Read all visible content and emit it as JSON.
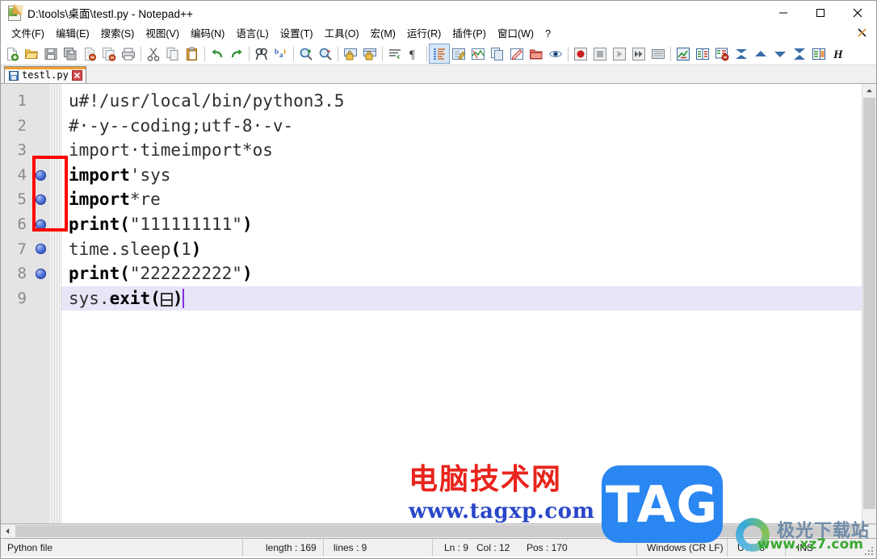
{
  "window": {
    "title": "D:\\tools\\桌面\\testl.py - Notepad++",
    "icon": "notepad-plus-plus-icon",
    "controls": {
      "minimize": "–",
      "maximize": "□",
      "close": "✕"
    }
  },
  "menu": {
    "items": [
      {
        "label": "文件(F)"
      },
      {
        "label": "编辑(E)"
      },
      {
        "label": "搜索(S)"
      },
      {
        "label": "视图(V)"
      },
      {
        "label": "编码(N)"
      },
      {
        "label": "语言(L)"
      },
      {
        "label": "设置(T)"
      },
      {
        "label": "工具(O)"
      },
      {
        "label": "宏(M)"
      },
      {
        "label": "运行(R)"
      },
      {
        "label": "插件(P)"
      },
      {
        "label": "窗口(W)"
      },
      {
        "label": "?"
      }
    ],
    "close_document_label": "✕"
  },
  "toolbar": {
    "groups": [
      [
        "new-file-icon",
        "open-file-icon",
        "save-icon",
        "save-all-icon",
        "close-file-icon",
        "close-all-icon",
        "print-icon"
      ],
      [
        "cut-icon",
        "copy-icon",
        "paste-icon"
      ],
      [
        "undo-icon",
        "redo-icon"
      ],
      [
        "find-icon",
        "replace-icon"
      ],
      [
        "zoom-in-icon",
        "zoom-out-icon"
      ],
      [
        "sync-vertical-scroll-icon",
        "sync-horizontal-scroll-icon"
      ],
      [
        "word-wrap-icon",
        "show-all-characters-icon"
      ],
      [
        "indent-guide-icon",
        "user-defined-language-icon",
        "document-map-icon",
        "function-list-icon",
        "edit-annotation-icon",
        "folder-workspace-icon",
        "show-spy-icon"
      ],
      [
        "macro-record-icon",
        "macro-stop-icon",
        "macro-play-icon",
        "macro-playback-multiple-icon",
        "macro-save-icon"
      ],
      [
        "run-icon",
        "compare-icon",
        "compare-clear-icon",
        "collapse-all-icon",
        "collapse-up-icon",
        "expand-down-icon",
        "expand-all-icon",
        "settings-compare-icon",
        "hex-editor-icon"
      ]
    ]
  },
  "tabs": [
    {
      "label": "testl.py",
      "icon": "saved-document-icon",
      "close": "✕",
      "active": true
    }
  ],
  "editor": {
    "lines": [
      {
        "num": "1",
        "bookmark": false,
        "current": false,
        "tokens": [
          {
            "t": "u#!/usr/local/bin/python3.5",
            "style": "plain"
          }
        ]
      },
      {
        "num": "2",
        "bookmark": false,
        "current": false,
        "tokens": [
          {
            "t": "#·-y--coding;utf-8·-v-",
            "style": "plain"
          }
        ]
      },
      {
        "num": "3",
        "bookmark": false,
        "current": false,
        "tokens": [
          {
            "t": "import·timeimport*os",
            "style": "plain"
          }
        ]
      },
      {
        "num": "4",
        "bookmark": true,
        "current": false,
        "tokens": [
          {
            "t": "import",
            "style": "kw"
          },
          {
            "t": "'sys",
            "style": "plain"
          }
        ]
      },
      {
        "num": "5",
        "bookmark": true,
        "current": false,
        "tokens": [
          {
            "t": "import",
            "style": "kw"
          },
          {
            "t": "*re",
            "style": "plain"
          }
        ]
      },
      {
        "num": "6",
        "bookmark": true,
        "current": false,
        "tokens": [
          {
            "t": "print",
            "style": "kw"
          },
          {
            "t": "(",
            "style": "kw"
          },
          {
            "t": "\"111111111\"",
            "style": "plain"
          },
          {
            "t": ")",
            "style": "kw"
          }
        ]
      },
      {
        "num": "7",
        "bookmark": true,
        "current": false,
        "tokens": [
          {
            "t": "time.sleep",
            "style": "plain"
          },
          {
            "t": "(",
            "style": "kw"
          },
          {
            "t": "1",
            "style": "plain"
          },
          {
            "t": ")",
            "style": "kw"
          }
        ]
      },
      {
        "num": "8",
        "bookmark": true,
        "current": false,
        "tokens": [
          {
            "t": "print",
            "style": "kw"
          },
          {
            "t": "(",
            "style": "kw"
          },
          {
            "t": "\"222222222\"",
            "style": "plain"
          },
          {
            "t": ")",
            "style": "kw"
          }
        ]
      },
      {
        "num": "9",
        "bookmark": false,
        "current": true,
        "tokens": [
          {
            "t": "sys.",
            "style": "plain"
          },
          {
            "t": "exit",
            "style": "kw"
          },
          {
            "t": "(",
            "style": "kw"
          },
          {
            "t": "BOX",
            "style": "box"
          },
          {
            "t": ")",
            "style": "kw"
          },
          {
            "t": "CARET",
            "style": "caret"
          }
        ]
      }
    ],
    "annotation": {
      "color": "#ff0000",
      "name": "bookmark-margin-highlight"
    }
  },
  "statusbar": {
    "file_type": "Python file",
    "length": "length : 169",
    "lines": "lines : 9",
    "ln": "Ln : 9",
    "col": "Col : 12",
    "pos": "Pos : 170",
    "eol": "Windows (CR LF)",
    "encoding": "UTF-8",
    "insert_mode": "INS"
  },
  "watermarks": {
    "tag": {
      "cn": "电脑技术网",
      "url": "www.tagxp.com",
      "badge": "TAG",
      "cn_color": "#e8241c",
      "url_color": "#2a47c8",
      "badge_color": "#2a86f0"
    },
    "xz": {
      "cn": "极光下载站",
      "url": "www.xz7.com",
      "cn_color": "#6f8ba8",
      "url_color": "#3aa832"
    }
  }
}
